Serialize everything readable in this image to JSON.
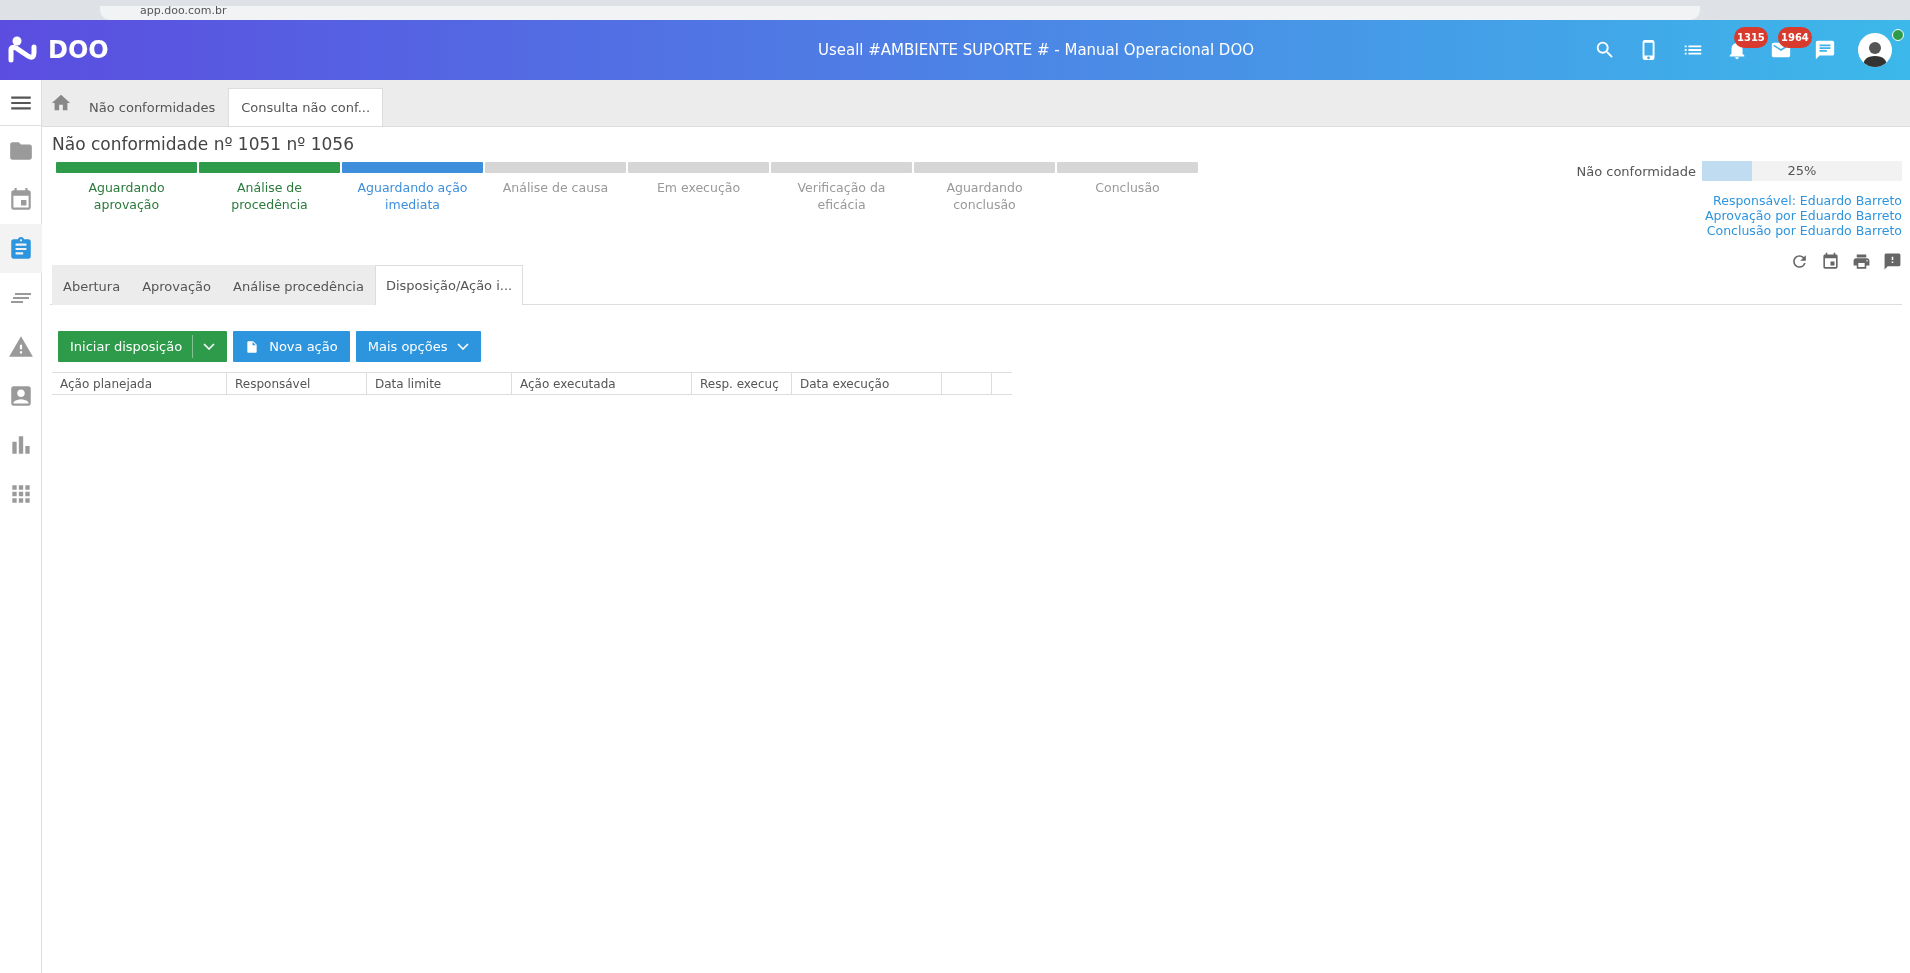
{
  "browser": {
    "url": "app.doo.com.br"
  },
  "header": {
    "logo": "DOO",
    "title": "Useall #AMBIENTE SUPORTE # - Manual Operacional DOO",
    "notifications": "1315",
    "messages": "1964"
  },
  "sidebar": {
    "items": [
      {
        "selected": false
      },
      {
        "selected": false
      },
      {
        "selected": true
      },
      {
        "selected": false
      },
      {
        "selected": false
      },
      {
        "selected": false
      },
      {
        "selected": false
      },
      {
        "selected": false
      }
    ]
  },
  "breadcrumb_tabs": [
    {
      "label": "Não conformidades",
      "selected": false
    },
    {
      "label": "Consulta não conf...",
      "selected": true
    }
  ],
  "page_title": "Não conformidade nº 1051 nº 1056",
  "steps": [
    {
      "label": "Aguardando aprovação",
      "kind": "done"
    },
    {
      "label": "Análise de procedência",
      "kind": "done"
    },
    {
      "label": "Aguardando ação imediata",
      "kind": "current"
    },
    {
      "label": "Análise de causa",
      "kind": "pending"
    },
    {
      "label": "Em execução",
      "kind": "pending"
    },
    {
      "label": "Verificação da eficácia",
      "kind": "pending"
    },
    {
      "label": "Aguardando conclusão",
      "kind": "pending"
    },
    {
      "label": "Conclusão",
      "kind": "pending"
    }
  ],
  "progress": {
    "label": "Não conformidade",
    "level": 0.25,
    "reading": "25%"
  },
  "info_links": [
    "Responsável: Eduardo Barreto",
    "Aprovação por Eduardo Barreto",
    "Conclusão por Eduardo Barreto"
  ],
  "tabs": [
    {
      "label": "Abertura",
      "selected": false
    },
    {
      "label": "Aprovação",
      "selected": false
    },
    {
      "label": "Análise procedência",
      "selected": false
    },
    {
      "label": "Disposição/Ação i...",
      "selected": true
    }
  ],
  "buttons": [
    {
      "label": "Iniciar disposição",
      "kind": "split"
    },
    {
      "label": "Nova ação",
      "kind": "doc"
    },
    {
      "label": "Mais opções",
      "kind": "menu"
    }
  ],
  "table": {
    "columns": [
      "Ação planejada",
      "Responsável",
      "Data limite",
      "Ação executada",
      "Resp. execuç",
      "Data execução"
    ]
  }
}
